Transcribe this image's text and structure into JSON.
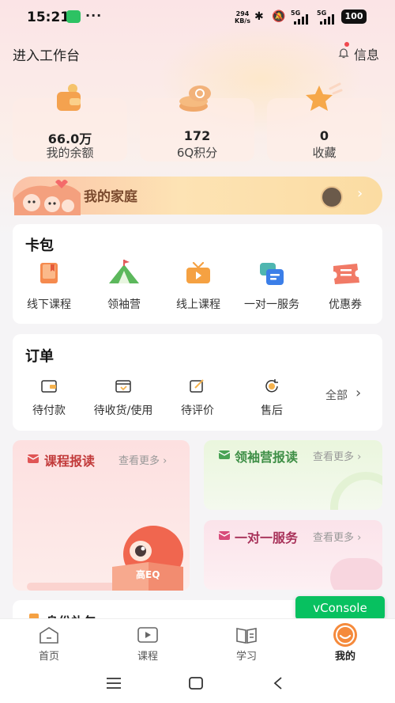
{
  "status_bar": {
    "time": "15:21",
    "dots": "···",
    "net_speed": "294",
    "net_unit": "KB/s",
    "bluetooth_icon": "bluetooth-icon",
    "mute_icon": "mute-icon",
    "sim1": "5G",
    "sim2": "5G",
    "battery": "100"
  },
  "header": {
    "title": "进入工作台",
    "message_label": "信息"
  },
  "stats": [
    {
      "value": "66.0万",
      "label": "我的余额",
      "icon": "wallet-icon"
    },
    {
      "value": "172",
      "label": "6Q积分",
      "icon": "coins-icon"
    },
    {
      "value": "0",
      "label": "收藏",
      "icon": "star-icon"
    }
  ],
  "family": {
    "title": "我的家庭",
    "arrow": "›"
  },
  "card_pack": {
    "title": "卡包",
    "items": [
      {
        "label": "线下课程",
        "icon": "book-icon"
      },
      {
        "label": "领袖营",
        "icon": "tent-icon"
      },
      {
        "label": "线上课程",
        "icon": "tv-icon"
      },
      {
        "label": "一对一服务",
        "icon": "chat-icon"
      },
      {
        "label": "优惠券",
        "icon": "ticket-icon"
      }
    ]
  },
  "orders": {
    "title": "订单",
    "items": [
      {
        "label": "待付款",
        "icon": "wallet-outline-icon"
      },
      {
        "label": "待收货/使用",
        "icon": "package-icon"
      },
      {
        "label": "待评价",
        "icon": "edit-icon"
      },
      {
        "label": "售后",
        "icon": "refund-icon"
      }
    ],
    "all_label": "全部",
    "all_arrow": "›"
  },
  "promos": {
    "course": {
      "title": "课程报读",
      "more": "查看更多 ›",
      "badge": "高EQ"
    },
    "leader": {
      "title": "领袖营报读",
      "more": "查看更多 ›"
    },
    "service": {
      "title": "一对一服务",
      "more": "查看更多 ›"
    },
    "partial": {
      "title": "身份礼包"
    }
  },
  "vconsole": "vConsole",
  "tabs": [
    {
      "label": "首页",
      "icon": "home-icon"
    },
    {
      "label": "课程",
      "icon": "video-icon"
    },
    {
      "label": "学习",
      "icon": "book-open-icon"
    },
    {
      "label": "我的",
      "icon": "smile-icon"
    }
  ],
  "colors": {
    "accent_red": "#d2403e",
    "accent_green": "#4aa355",
    "accent_pink": "#c2356a",
    "vconsole_green": "#07c160"
  }
}
